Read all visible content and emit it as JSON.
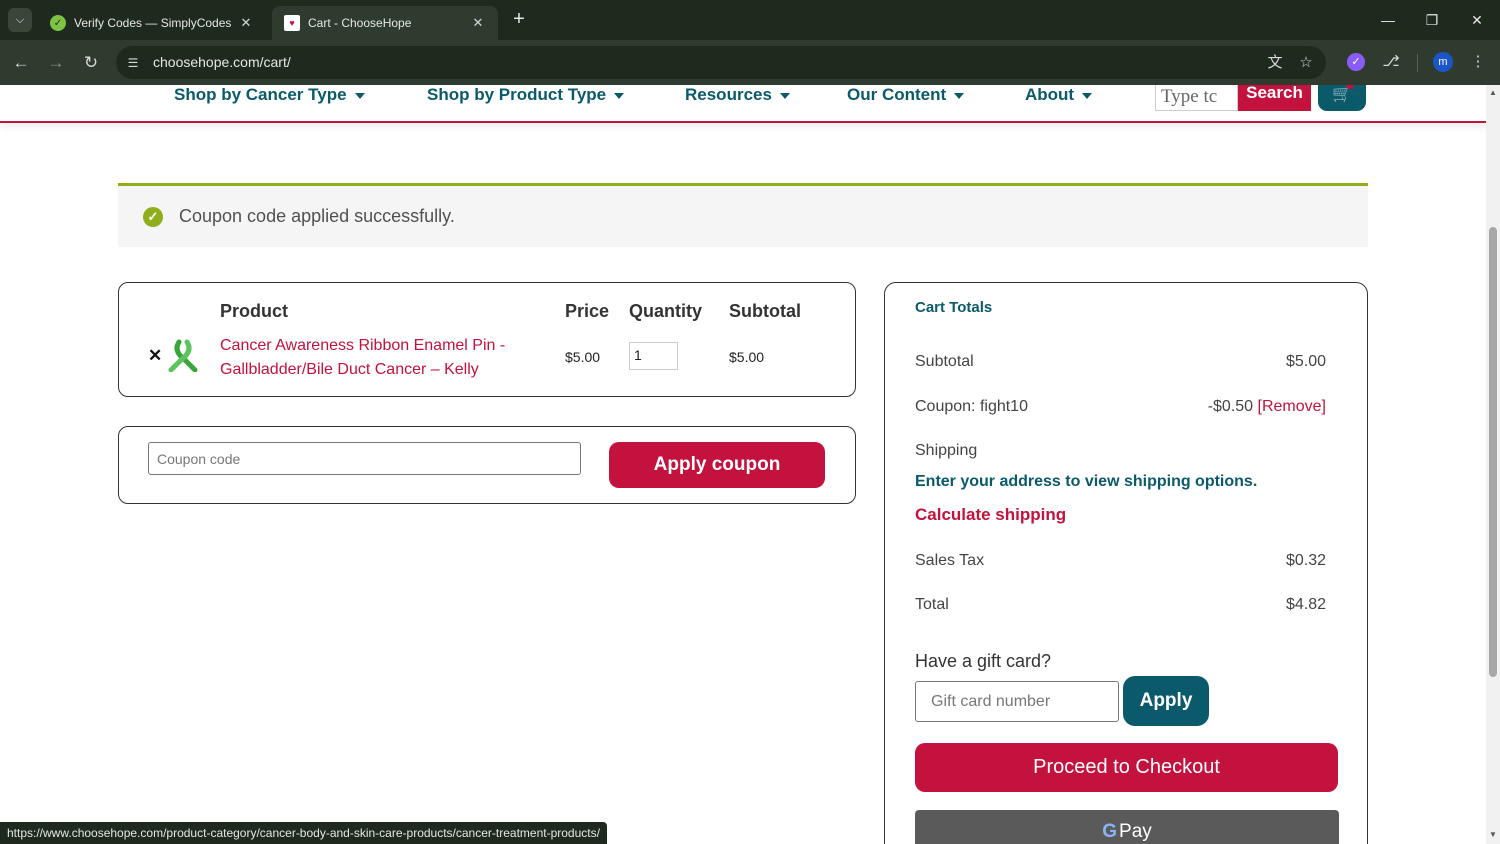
{
  "browser": {
    "tabs": [
      {
        "title": "Verify Codes — SimplyCodes",
        "active": false
      },
      {
        "title": "Cart - ChooseHope",
        "active": true
      }
    ],
    "url": "choosehope.com/cart/",
    "profile_initial": "m",
    "status_url": "https://www.choosehope.com/product-category/cancer-body-and-skin-care-products/cancer-treatment-products/"
  },
  "site_nav": {
    "items": [
      {
        "label": "Shop by Cancer Type"
      },
      {
        "label": "Shop by Product Type"
      },
      {
        "label": "Resources"
      },
      {
        "label": "Our Content"
      },
      {
        "label": "About"
      }
    ],
    "search_value": "Type tc",
    "search_button": "Search"
  },
  "notice": {
    "message": "Coupon code applied successfully."
  },
  "cart_table": {
    "headers": {
      "product": "Product",
      "price": "Price",
      "quantity": "Quantity",
      "subtotal": "Subtotal"
    },
    "rows": [
      {
        "name": "Cancer Awareness Ribbon Enamel Pin - Gallbladder/Bile Duct Cancer – Kelly",
        "price": "$5.00",
        "quantity": "1",
        "subtotal": "$5.00"
      }
    ]
  },
  "coupon": {
    "placeholder": "Coupon code",
    "button": "Apply coupon"
  },
  "totals": {
    "title": "Cart Totals",
    "subtotal_label": "Subtotal",
    "subtotal_value": "$5.00",
    "coupon_label": "Coupon: fight10",
    "coupon_value": "-$0.50",
    "coupon_remove": "[Remove]",
    "shipping_label": "Shipping",
    "shipping_message": "Enter your address to view shipping options.",
    "calculate_shipping": "Calculate shipping",
    "tax_label": "Sales Tax",
    "tax_value": "$0.32",
    "total_label": "Total",
    "total_value": "$4.82",
    "gift_title": "Have a gift card?",
    "gift_placeholder": "Gift card number",
    "gift_apply": "Apply",
    "checkout": "Proceed to Checkout",
    "gpay": "Pay"
  },
  "colors": {
    "brand_red": "#c3123d",
    "brand_teal": "#0b5a6b",
    "success_green": "#8fae1b"
  }
}
